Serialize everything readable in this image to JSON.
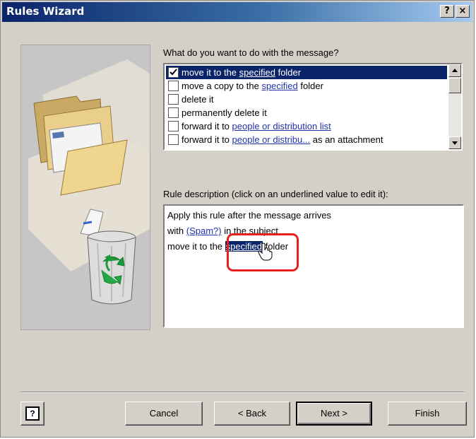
{
  "window": {
    "title": "Rules Wizard",
    "help_button": "?",
    "close_button": "×"
  },
  "actions": {
    "prompt": "What do you want to do with the message?",
    "items": [
      {
        "checked": true,
        "selected": true,
        "before": "move it to the ",
        "link": "specified",
        "after": " folder"
      },
      {
        "checked": false,
        "selected": false,
        "before": "move a copy to the ",
        "link": "specified",
        "after": " folder"
      },
      {
        "checked": false,
        "selected": false,
        "before": "delete it",
        "link": "",
        "after": ""
      },
      {
        "checked": false,
        "selected": false,
        "before": "permanently delete it",
        "link": "",
        "after": ""
      },
      {
        "checked": false,
        "selected": false,
        "before": "forward it to ",
        "link": "people or distribution list",
        "after": ""
      },
      {
        "checked": false,
        "selected": false,
        "before": "forward it to ",
        "link": "people or distribu...",
        "after": " as an attachment"
      }
    ]
  },
  "description": {
    "label": "Rule description (click on an underlined value to edit it):",
    "line1": "Apply this rule after the message arrives",
    "line2_before": "with ",
    "line2_link": "(Spam?)",
    "line2_after": " in the subject",
    "line3_before": "move it to the ",
    "line3_link": "specified",
    "line3_after": " folder"
  },
  "buttons": {
    "help": "?",
    "cancel": "Cancel",
    "back": "< Back",
    "next": "Next >",
    "finish": "Finish"
  },
  "colors": {
    "title_bar": "#0a246a",
    "selection": "#0a246a",
    "link": "#2233aa",
    "annotation": "#e8201c"
  }
}
